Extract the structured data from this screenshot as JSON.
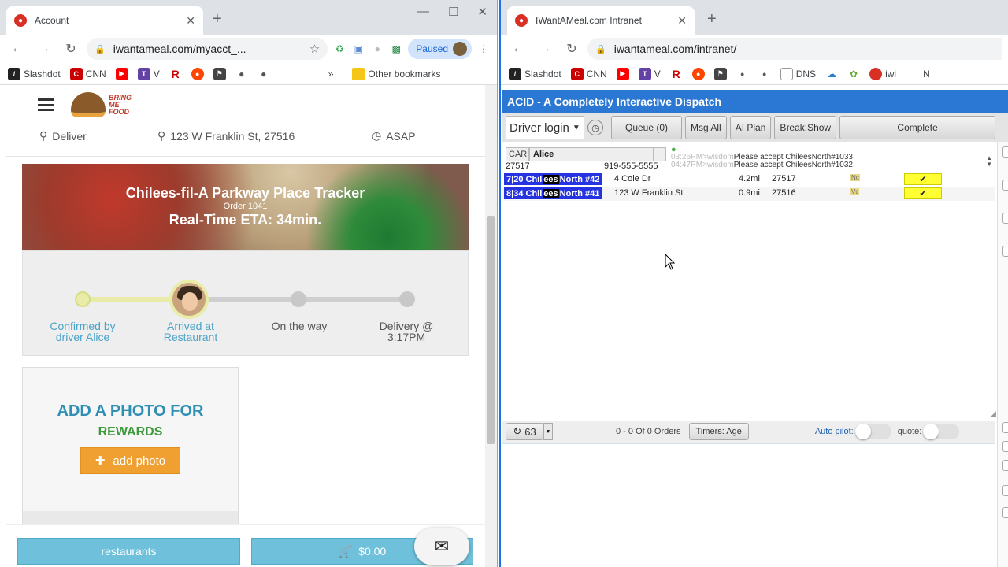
{
  "left_window": {
    "tab_title": "Account",
    "url": "iwantameal.com/myacct_...",
    "paused_label": "Paused",
    "bookmarks": [
      "Slashdot",
      "CNN",
      "V"
    ],
    "other_bookmarks": "Other bookmarks",
    "site": {
      "logo_text": "BRING ME FOOD",
      "order_type": "Deliver",
      "address": "123 W Franklin St, 27516",
      "time": "ASAP",
      "tracker": {
        "title": "Chilees-fil-A Parkway Place Tracker",
        "order": "Order 1041",
        "eta": "Real-Time ETA: 34min.",
        "progress_fraction": 0.33,
        "steps": [
          {
            "label": "Confirmed by driver Alice"
          },
          {
            "label": "Arrived at Restaurant"
          },
          {
            "label": "On the way"
          },
          {
            "label": "Delivery @ 3:17PM"
          }
        ]
      },
      "photo": {
        "heading": "ADD A PHOTO FOR",
        "subheading": "REWARDS",
        "button": "add photo",
        "strip_text": "coleslaw"
      },
      "bottom": {
        "restaurants": "restaurants",
        "cart": "$0.00"
      }
    }
  },
  "right_window": {
    "tab_title": "IWantAMeal.com Intranet",
    "url": "iwantameal.com/intranet/",
    "bookmarks": [
      "Slashdot",
      "CNN",
      "V",
      "DNS",
      "iwi",
      "N"
    ],
    "acid": {
      "title": "ACID - A Completely Interactive Dispatch",
      "driver_select": "Driver login",
      "buttons": {
        "queue": "Queue (0)",
        "msg_all": "Msg All",
        "ai_plan": "AI Plan",
        "break": "Break:Show",
        "complete": "Complete"
      },
      "car_label": "CAR",
      "driver_name": "Alice",
      "driver_zip": "27517",
      "driver_phone": "919-555-5555",
      "messages": [
        {
          "time": "03:26PM>wisdom",
          "text": "Please accept ChileesNorth#1033"
        },
        {
          "time": "04:47PM>wisdom",
          "text": "Please accept ChileesNorth#1032"
        }
      ],
      "orders": [
        {
          "num": "7|20",
          "rest_a": "Chil",
          "rest_b": "ees",
          "rest_c": "North",
          "id": "#42",
          "address": "4 Cole Dr",
          "dist": "4.2mi",
          "zip": "27517",
          "code": "Nc"
        },
        {
          "num": "8|34",
          "rest_a": "Chil",
          "rest_b": "ees",
          "rest_c": "North",
          "id": "#41",
          "address": "123 W Franklin St",
          "dist": "0.9mi",
          "zip": "27516",
          "code": "Vc"
        }
      ],
      "footer": {
        "refresh_count": "63",
        "orders_text": "0 - 0 Of 0 Orders",
        "timers": "Timers: Age",
        "autopilot": "Auto pilot:",
        "quote": "quote:"
      }
    }
  }
}
